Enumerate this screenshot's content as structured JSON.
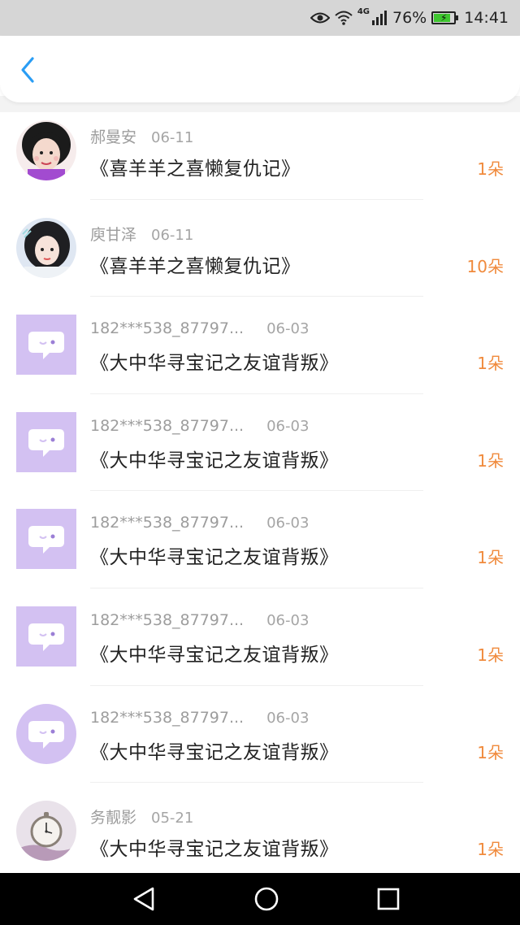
{
  "status_bar": {
    "network": "4G",
    "battery": "76%",
    "time": "14:41",
    "icons": [
      "eye-icon",
      "wifi-icon",
      "signal-icon",
      "battery-icon"
    ]
  },
  "header": {
    "back_icon": "chevron-left-icon",
    "accent_color": "#2a9df4"
  },
  "items": [
    {
      "name": "郝曼安",
      "date": "06-11",
      "title": "《喜羊羊之喜懒复仇记》",
      "count": "1朵",
      "avatar": "photo-girl-1"
    },
    {
      "name": "庾甘泽",
      "date": "06-11",
      "title": "《喜羊羊之喜懒复仇记》",
      "count": "10朵",
      "avatar": "photo-girl-2"
    },
    {
      "name": "182***538_87797...",
      "date": "06-03",
      "title": "《大中华寻宝记之友谊背叛》",
      "count": "1朵",
      "avatar": "default-chat-bubble-square"
    },
    {
      "name": "182***538_87797...",
      "date": "06-03",
      "title": "《大中华寻宝记之友谊背叛》",
      "count": "1朵",
      "avatar": "default-chat-bubble-square"
    },
    {
      "name": "182***538_87797...",
      "date": "06-03",
      "title": "《大中华寻宝记之友谊背叛》",
      "count": "1朵",
      "avatar": "default-chat-bubble-square"
    },
    {
      "name": "182***538_87797...",
      "date": "06-03",
      "title": "《大中华寻宝记之友谊背叛》",
      "count": "1朵",
      "avatar": "default-chat-bubble-square"
    },
    {
      "name": "182***538_87797...",
      "date": "06-03",
      "title": "《大中华寻宝记之友谊背叛》",
      "count": "1朵",
      "avatar": "default-chat-bubble-circle"
    },
    {
      "name": "务靓影",
      "date": "05-21",
      "title": "《大中华寻宝记之友谊背叛》",
      "count": "1朵",
      "avatar": "photo-pocket-watch"
    }
  ],
  "colors": {
    "count": "#f08a3c",
    "name": "#9d9d9d",
    "title": "#222222",
    "avatar_default_bg": "#d3c1f2"
  },
  "nav_bar": {
    "icons": [
      "back-triangle-icon",
      "home-circle-icon",
      "recents-square-icon"
    ]
  }
}
